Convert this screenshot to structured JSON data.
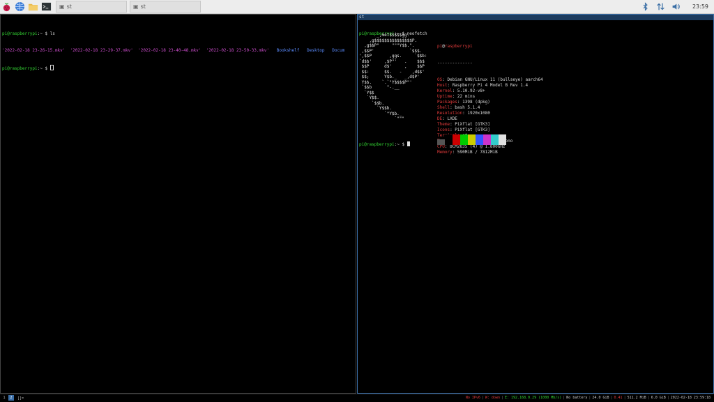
{
  "panel": {
    "launchers": [
      {
        "icon": "raspberry-menu-icon"
      },
      {
        "icon": "web-browser-icon"
      },
      {
        "icon": "file-manager-icon"
      },
      {
        "icon": "terminal-icon"
      }
    ],
    "tasks": [
      {
        "label": "st",
        "icon": "window-icon"
      },
      {
        "label": "st",
        "icon": "window-icon"
      }
    ],
    "tray": {
      "icons": [
        "bluetooth-icon",
        "network-arrows-icon",
        "volume-icon"
      ],
      "clock": "23:59"
    }
  },
  "left_pane": {
    "title": "",
    "prompt_user": "pi@raspberrypi",
    "prompt_path": ":~ $",
    "command1": "ls",
    "files": [
      {
        "name": "'2022-02-18 23-26-15.mkv'",
        "type": "mkv"
      },
      {
        "name": "'2022-02-18 23-29-37.mkv'",
        "type": "mkv"
      },
      {
        "name": "'2022-02-18 23-40-48.mkv'",
        "type": "mkv"
      },
      {
        "name": "'2022-02-18 23-50-33.mkv'",
        "type": "mkv"
      },
      {
        "name": "Bookshelf",
        "type": "dir"
      },
      {
        "name": "Desktop",
        "type": "dir"
      },
      {
        "name": "Docum",
        "type": "dir"
      }
    ]
  },
  "right_pane": {
    "title": "st",
    "prompt_user": "pi@raspberrypi",
    "prompt_path": ":~ $",
    "command": "neofetch",
    "header_user": "pi",
    "header_at": "@",
    "header_host": "raspberrypi",
    "divider": "--------------",
    "info": [
      {
        "label": "OS",
        "value": "Debian GNU/Linux 11 (bullseye) aarch64"
      },
      {
        "label": "Host",
        "value": "Raspberry Pi 4 Model B Rev 1.4"
      },
      {
        "label": "Kernel",
        "value": "5.10.92-v8+"
      },
      {
        "label": "Uptime",
        "value": "22 mins"
      },
      {
        "label": "Packages",
        "value": "1398 (dpkg)"
      },
      {
        "label": "Shell",
        "value": "bash 5.1.4"
      },
      {
        "label": "Resolution",
        "value": "1920x1080"
      },
      {
        "label": "DE",
        "value": "LXDE"
      },
      {
        "label": "Theme",
        "value": "PiXflat [GTK3]"
      },
      {
        "label": "Icons",
        "value": "PiXflat [GTK3]"
      },
      {
        "label": "Terminal",
        "value": "st"
      },
      {
        "label": "Terminal Font",
        "value": "Liberation Mono"
      },
      {
        "label": "CPU",
        "value": "BCM2835 (4) @ 1.800GHz"
      },
      {
        "label": "Memory",
        "value": "590MiB / 7812MiB"
      }
    ],
    "logo_lines": [
      "       _,met$$$$$gg.",
      "    ,g$$$$$$$$$$$$$$$P.",
      "  ,g$$P\"     \"\"\"Y$$.\".",
      " ,$$P'              `$$$.",
      "',$$P       ,ggs.     `$$b:",
      "`d$$'     ,$P\"'   .    $$$",
      " $$P      d$'     ,    $$P",
      " $$:      $$.   -    ,d$$'",
      " $$;      Y$b._   _,d$P'",
      " Y$$.    `.`\"Y$$$$P\"'",
      " `$$b      \"-.__",
      "  `Y$$",
      "   `Y$$.",
      "     `$$b.",
      "       `Y$$b.",
      "          `\"Y$b._",
      "              `\"\"\""
    ],
    "palette": [
      "#000000",
      "#cc0000",
      "#00cc00",
      "#cccc00",
      "#3355ff",
      "#cc33cc",
      "#33cccc",
      "#e0e0e0"
    ],
    "palette_dim": [
      "#555555"
    ]
  },
  "statusbar": {
    "tags": [
      "1",
      "2"
    ],
    "active_tag": 1,
    "layout_symbol": "[]=",
    "segments": [
      {
        "text": "No IPv6",
        "color": "#e23b3b"
      },
      {
        "text": "W: down",
        "color": "#e23b3b"
      },
      {
        "text": "E: 192.168.0.29 (1000 Mb/s)",
        "color": "#33d633"
      },
      {
        "text": "No battery",
        "color": "#cccccc"
      },
      {
        "text": "24.0 GiB",
        "color": "#cccccc"
      },
      {
        "text": "0.41",
        "color": "#e23b3b"
      },
      {
        "text": "511.2 MiB",
        "color": "#cccccc"
      },
      {
        "text": "6.0 GiB",
        "color": "#cccccc"
      },
      {
        "text": "2022-02-18 23:59:18",
        "color": "#cccccc"
      }
    ]
  }
}
